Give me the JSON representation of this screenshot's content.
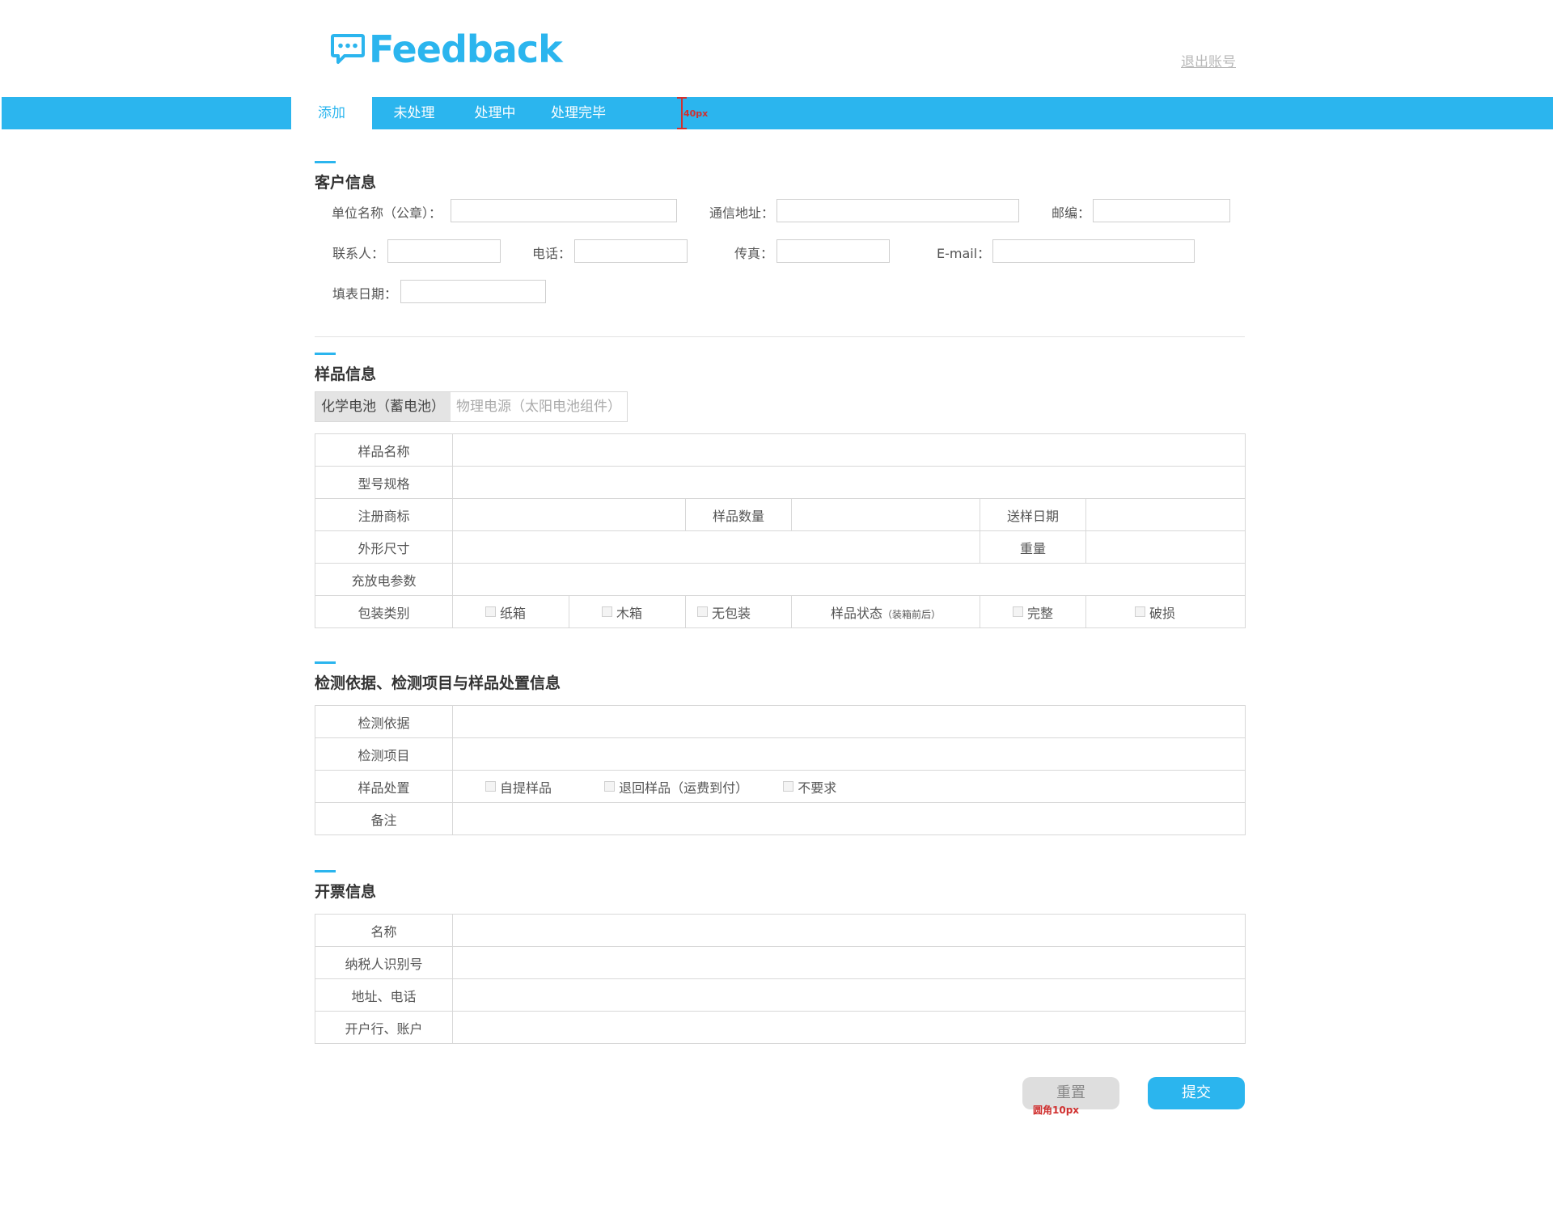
{
  "header": {
    "logo_text": "Feedback",
    "logout_label": "退出账号"
  },
  "nav": {
    "tabs": [
      {
        "label": "添加",
        "active": true
      },
      {
        "label": "未处理",
        "active": false
      },
      {
        "label": "处理中",
        "active": false
      },
      {
        "label": "处理完毕",
        "active": false
      }
    ],
    "measure_note": "40px"
  },
  "customer": {
    "title": "客户信息",
    "fields": {
      "company": "单位名称（公章）：",
      "address": "通信地址：",
      "postcode": "邮编：",
      "contact": "联系人：",
      "phone": "电话：",
      "fax": "传真：",
      "email": "E-mail：",
      "date": "填表日期："
    }
  },
  "sample": {
    "title": "样品信息",
    "tabs": [
      {
        "label": "化学电池（蓄电池）",
        "active": true
      },
      {
        "label": "物理电源（太阳电池组件）",
        "active": false
      }
    ],
    "rows": {
      "name": "样品名称",
      "model": "型号规格",
      "trademark": "注册商标",
      "quantity": "样品数量",
      "send_date": "送样日期",
      "size": "外形尺寸",
      "weight": "重量",
      "charge": "充放电参数",
      "package": "包装类别",
      "status": "样品状态",
      "status_note": "（装箱前后）"
    },
    "package_options": [
      "纸箱",
      "木箱",
      "无包装"
    ],
    "status_options": [
      "完整",
      "破损"
    ]
  },
  "testing": {
    "title": "检测依据、检测项目与样品处置信息",
    "rows": {
      "basis": "检测依据",
      "items": "检测项目",
      "disposal": "样品处置",
      "remark": "备注"
    },
    "disposal_options": [
      "自提样品",
      "退回样品（运费到付）",
      "不要求"
    ]
  },
  "invoice": {
    "title": "开票信息",
    "rows": {
      "name": "名称",
      "tax_id": "纳税人识别号",
      "addr_phone": "地址、电话",
      "bank": "开户行、账户"
    }
  },
  "actions": {
    "reset_label": "重置",
    "submit_label": "提交",
    "radius_note": "圆角10px"
  },
  "colors": {
    "accent": "#2bb5ee",
    "annotation": "#d0302f"
  }
}
